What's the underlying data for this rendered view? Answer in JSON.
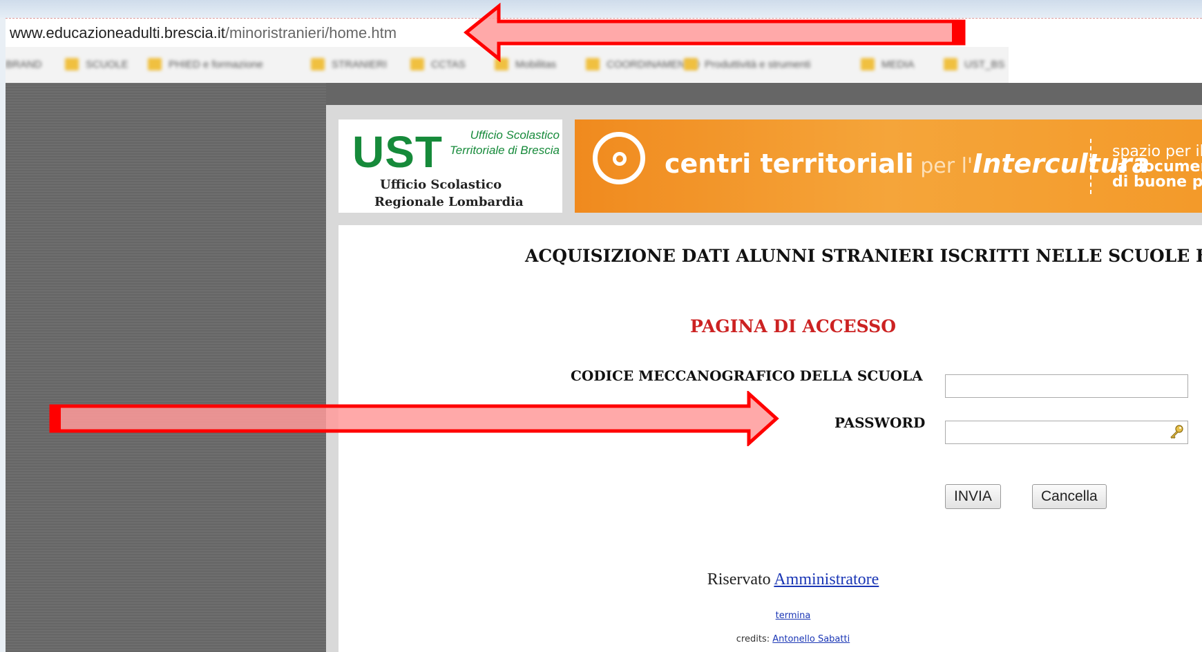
{
  "browser": {
    "url_host": "www.educazioneadulti.brescia.it",
    "url_path": "/minoristranieri/home.htm",
    "bookmarks": [
      {
        "label": "BRAND",
        "icon": "folder-icon"
      },
      {
        "label": "SCUOLE",
        "icon": "folder-icon"
      },
      {
        "label": "PHIED e formazione",
        "icon": "folder-icon"
      },
      {
        "label": "STRANIERI",
        "icon": "folder-icon"
      },
      {
        "label": "CCTAS",
        "icon": "folder-icon"
      },
      {
        "label": "Mobilitas",
        "icon": "folder-icon"
      },
      {
        "label": "COORDINAMENTO",
        "icon": "folder-icon"
      },
      {
        "label": "Produttività e strumenti",
        "icon": "folder-icon"
      },
      {
        "label": "MEDIA",
        "icon": "folder-icon"
      },
      {
        "label": "UST_BS",
        "icon": "folder-icon"
      }
    ]
  },
  "header": {
    "logo_ust": "UST",
    "logo_sub": "Ufficio Scolastico Territoriale di Brescia",
    "logo_usr_line1": "Ufficio Scolastico",
    "logo_usr_line2": "Regionale Lombardia",
    "banner_a": "centri territoriali",
    "banner_b": " per l'",
    "banner_c": "Intercultura",
    "banner_side1": "spazio per il co",
    "banner_side2": "la documen",
    "banner_side3": "di buone p",
    "banner_color": "#f5a53a"
  },
  "main": {
    "title": "ACQUISIZIONE DATI ALUNNI STRANIERI ISCRITTI NELLE SCUOLE BRES",
    "subtitle": "PAGINA DI ACCESSO",
    "code_label": "CODICE MECCANOGRAFICO DELLA SCUOLA",
    "code_value": "",
    "password_label": "PASSWORD",
    "password_value": "",
    "submit_label": "INVIA",
    "cancel_label": "Cancella",
    "reserved_text": "Riservato ",
    "reserved_link": "Amministratore",
    "termina_link": "termina",
    "credits_text": "credits: ",
    "credits_link": "Antonello Sabatti"
  },
  "colors": {
    "arrow": "#ff0000",
    "arrow_fill": "#ff9a9a",
    "subtitle": "#cc2222",
    "link": "#1a36b5"
  }
}
